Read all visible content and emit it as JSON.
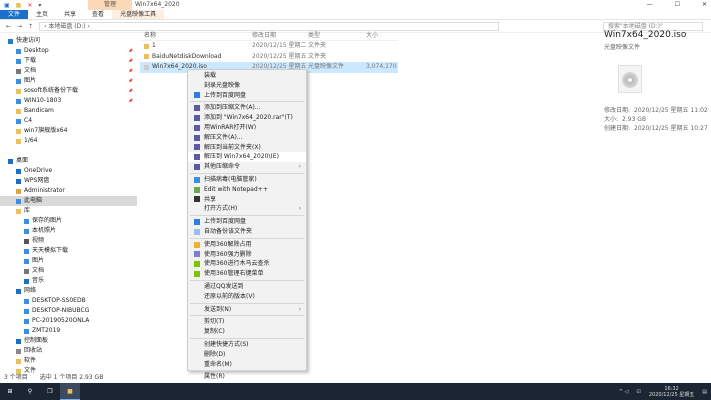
{
  "window": {
    "title": "Win7x64_2020",
    "contextual_group": "管理",
    "controls": [
      "—",
      "☐",
      "✕"
    ]
  },
  "ribbon": {
    "tabs": [
      "文件",
      "主页",
      "共享",
      "查看",
      "光盘映像工具"
    ]
  },
  "address": {
    "path": "› 本地磁盘 (D:) ›",
    "search_placeholder": "搜索\"本地磁盘 (D:)\""
  },
  "nav": [
    {
      "label": "快速访问",
      "icon": "star-icon",
      "color": "#2a7ad5",
      "indent": 0
    },
    {
      "label": "Desktop",
      "icon": "folder-icon",
      "color": "#3a8fe0",
      "indent": 1,
      "pin": true
    },
    {
      "label": "下载",
      "icon": "download-icon",
      "color": "#3a8fe0",
      "indent": 1,
      "pin": true
    },
    {
      "label": "文档",
      "icon": "document-icon",
      "color": "#777",
      "indent": 1,
      "pin": true
    },
    {
      "label": "图片",
      "icon": "picture-icon",
      "color": "#3a8fe0",
      "indent": 1,
      "pin": true
    },
    {
      "label": "sosoft系统备份下载",
      "icon": "folder-icon",
      "color": "#e8c15a",
      "indent": 1,
      "pin": true
    },
    {
      "label": "WIN10-1803",
      "icon": "drive-icon",
      "color": "#3a8fe0",
      "indent": 1,
      "pin": true
    },
    {
      "label": "Bandicam",
      "icon": "folder-icon",
      "color": "#e8c15a",
      "indent": 1
    },
    {
      "label": "C4",
      "icon": "folder-icon",
      "color": "#3a8fe0",
      "indent": 1
    },
    {
      "label": "win7旗舰版x64",
      "icon": "folder-icon",
      "color": "#e8c15a",
      "indent": 1
    },
    {
      "label": "1/64",
      "icon": "folder-icon",
      "color": "#e8c15a",
      "indent": 1
    },
    {
      "label": "",
      "icon": "",
      "indent": 0
    },
    {
      "label": "桌面",
      "icon": "desktop-icon",
      "color": "#1a6fc9",
      "indent": 0
    },
    {
      "label": "OneDrive",
      "icon": "cloud-icon",
      "color": "#1a6fc9",
      "indent": 1
    },
    {
      "label": "WPS网盘",
      "icon": "cloud-icon",
      "color": "#1a6fc9",
      "indent": 1
    },
    {
      "label": "Administrator",
      "icon": "user-icon",
      "color": "#d9a441",
      "indent": 1
    },
    {
      "label": "此电脑",
      "icon": "computer-icon",
      "color": "#3a8fe0",
      "indent": 1,
      "selected": true
    },
    {
      "label": "库",
      "icon": "library-icon",
      "color": "#e8c15a",
      "indent": 1
    },
    {
      "label": "保存的图片",
      "icon": "picture-icon",
      "color": "#3a8fe0",
      "indent": 2
    },
    {
      "label": "本机照片",
      "icon": "picture-icon",
      "color": "#3a8fe0",
      "indent": 2
    },
    {
      "label": "视频",
      "icon": "video-icon",
      "color": "#555",
      "indent": 2
    },
    {
      "label": "天天模拟下载",
      "icon": "picture-icon",
      "color": "#3a8fe0",
      "indent": 2
    },
    {
      "label": "图片",
      "icon": "picture-icon",
      "color": "#3a8fe0",
      "indent": 2
    },
    {
      "label": "文档",
      "icon": "document-icon",
      "color": "#777",
      "indent": 2
    },
    {
      "label": "音乐",
      "icon": "music-icon",
      "color": "#1a6fc9",
      "indent": 2
    },
    {
      "label": "网络",
      "icon": "network-icon",
      "color": "#1a6fc9",
      "indent": 1
    },
    {
      "label": "DESKTOP-SS0EDB",
      "icon": "computer-icon",
      "color": "#3a8fe0",
      "indent": 2
    },
    {
      "label": "DESKTOP-NIBUBCG",
      "icon": "computer-icon",
      "color": "#3a8fe0",
      "indent": 2
    },
    {
      "label": "PC-20190520ONLA",
      "icon": "computer-icon",
      "color": "#3a8fe0",
      "indent": 2
    },
    {
      "label": "ZMT2019",
      "icon": "computer-icon",
      "color": "#3a8fe0",
      "indent": 2
    },
    {
      "label": "控制面板",
      "icon": "control-panel-icon",
      "color": "#1a6fc9",
      "indent": 1
    },
    {
      "label": "回收站",
      "icon": "recycle-bin-icon",
      "color": "#888",
      "indent": 1
    },
    {
      "label": "软件",
      "icon": "folder-icon",
      "color": "#e8c15a",
      "indent": 1
    },
    {
      "label": "文件",
      "icon": "folder-icon",
      "color": "#e8c15a",
      "indent": 1
    }
  ],
  "list": {
    "headers": [
      "名称",
      "修改日期",
      "类型",
      "大小"
    ],
    "rows": [
      {
        "name": "1",
        "date": "2020/12/15 星期二 1...",
        "type": "文件夹",
        "size": "",
        "icon": "folder-icon"
      },
      {
        "name": "BaiduNetdiskDownload",
        "date": "2020/12/25 星期五 1...",
        "type": "文件夹",
        "size": "",
        "icon": "folder-icon"
      },
      {
        "name": "Win7x64_2020.iso",
        "date": "2020/12/25 星期五 1...",
        "type": "光盘映像文件",
        "size": "3,074,170 ...",
        "icon": "disc-image-icon",
        "selected": true
      }
    ]
  },
  "menu": [
    {
      "label": "装载",
      "icon": "disc-icon"
    },
    {
      "label": "刻录光盘映像"
    },
    {
      "label": "上传到百度网盘",
      "icon": "baidu-icon",
      "color": "#2d7ee6"
    },
    {
      "sep": true
    },
    {
      "label": "添加到压缩文件(A)...",
      "icon": "winrar-icon",
      "color": "#5a5aa8"
    },
    {
      "label": "添加到 \"Win7x64_2020.rar\"(T)",
      "icon": "winrar-icon",
      "color": "#5a5aa8"
    },
    {
      "label": "用WinRAR打开(W)",
      "icon": "winrar-icon",
      "color": "#5a5aa8"
    },
    {
      "label": "解压文件(A)...",
      "icon": "winrar-icon",
      "color": "#5a5aa8"
    },
    {
      "label": "解压到当前文件夹(X)",
      "icon": "winrar-icon",
      "color": "#5a5aa8"
    },
    {
      "label": "解压到 Win7x64_2020\\(E)",
      "icon": "winrar-icon",
      "color": "#5a5aa8",
      "highlight": true
    },
    {
      "label": "其他压缩命令",
      "icon": "winrar-icon",
      "color": "#5a5aa8",
      "submenu": true
    },
    {
      "sep": true
    },
    {
      "label": "扫描病毒(电脑管家)",
      "icon": "shield-icon",
      "color": "#3a8fe0"
    },
    {
      "label": "Edit with Notepad++",
      "icon": "notepad-icon",
      "color": "#6aa84f"
    },
    {
      "label": "共享",
      "icon": "share-icon",
      "color": "#333"
    },
    {
      "label": "打开方式(H)",
      "submenu": true
    },
    {
      "sep": true
    },
    {
      "label": "上传到百度网盘",
      "icon": "baidu-icon",
      "color": "#2d7ee6"
    },
    {
      "label": "自动备份该文件夹",
      "icon": "baidu-icon",
      "color": "#9bbfe8"
    },
    {
      "sep": true
    },
    {
      "label": "使用360解除占用",
      "icon": "unlock-icon",
      "color": "#f0b030"
    },
    {
      "label": "使用360强力删除",
      "icon": "delete-icon",
      "color": "#7b7bd8"
    },
    {
      "label": "使用360进行木马云查杀",
      "icon": "360-icon",
      "color": "#7cc400"
    },
    {
      "label": "使用360管理右键菜单",
      "icon": "360-icon",
      "color": "#7cc400"
    },
    {
      "sep": true
    },
    {
      "label": "通过QQ发送到"
    },
    {
      "label": "还原以前的版本(V)"
    },
    {
      "sep": true
    },
    {
      "label": "发送到(N)",
      "submenu": true
    },
    {
      "sep": true
    },
    {
      "label": "剪切(T)"
    },
    {
      "label": "复制(C)"
    },
    {
      "sep": true
    },
    {
      "label": "创建快捷方式(S)"
    },
    {
      "label": "删除(D)"
    },
    {
      "label": "重命名(M)"
    },
    {
      "sep": true
    },
    {
      "label": "属性(R)"
    }
  ],
  "details": {
    "title": "Win7x64_2020.iso",
    "subtitle": "光盘映像文件",
    "props": [
      [
        "修改日期:",
        "2020/12/25 星期五 11:02"
      ],
      [
        "大小:",
        "2.93 GB"
      ],
      [
        "创建日期:",
        "2020/12/25 星期五 10:27"
      ]
    ]
  },
  "status": {
    "count": "3 个项目",
    "selected": "选中 1 个项目 2.93 GB"
  },
  "taskbar": {
    "time": "16:32",
    "date": "2020/12/25 星期五"
  }
}
